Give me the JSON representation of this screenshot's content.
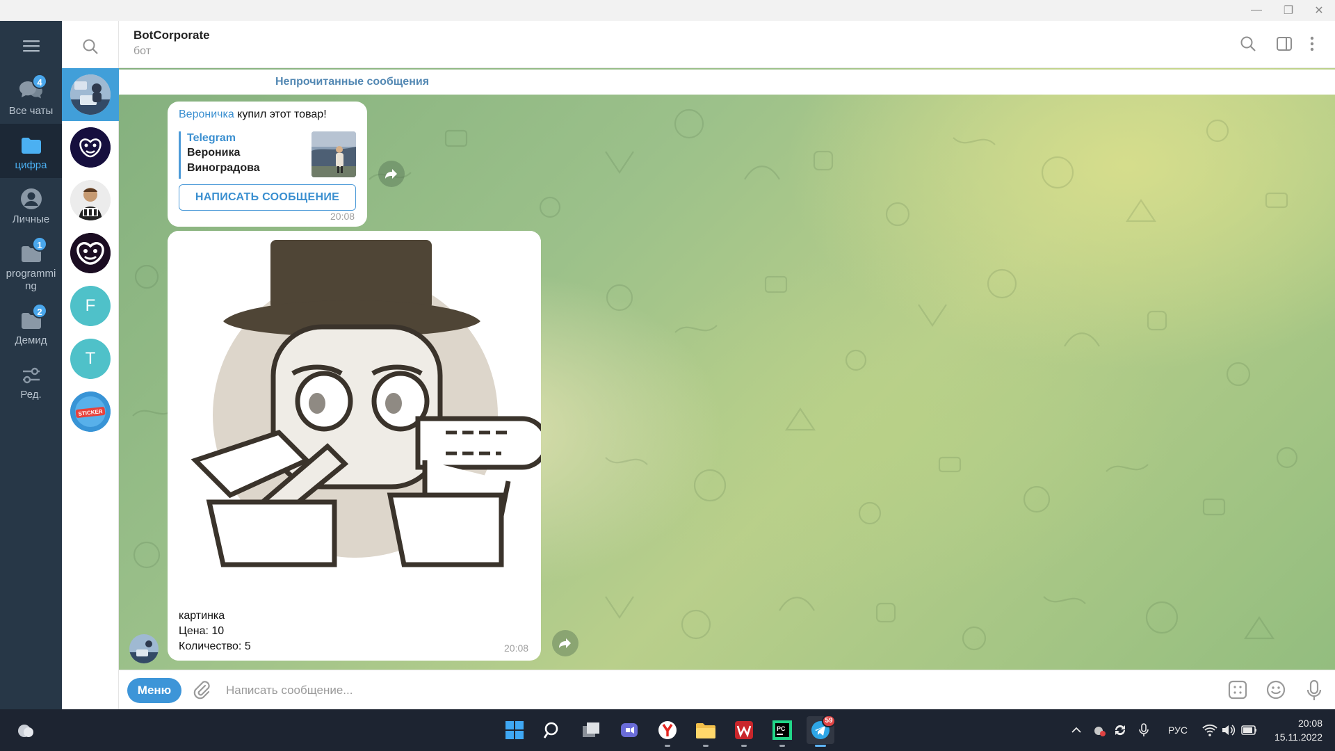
{
  "window": {
    "min": "—",
    "restore": "❐",
    "close": "✕"
  },
  "folders": [
    {
      "label": "Все чаты",
      "badge": "4",
      "icon": "chats-icon"
    },
    {
      "label": "цифра",
      "badge": "",
      "icon": "folder-icon",
      "active": true
    },
    {
      "label": "Личные",
      "badge": "",
      "icon": "person-icon"
    },
    {
      "label": "programmi ng",
      "badge": "1",
      "icon": "folder-icon"
    },
    {
      "label": "Демид",
      "badge": "2",
      "icon": "folder-icon"
    },
    {
      "label": "Ред.",
      "badge": "",
      "icon": "sliders-icon"
    }
  ],
  "chats": [
    {
      "type": "image",
      "name": "botcorporate-avatar",
      "active": true
    },
    {
      "type": "image",
      "name": "mask-avatar-1"
    },
    {
      "type": "image",
      "name": "person-avatar"
    },
    {
      "type": "image",
      "name": "mask-avatar-2"
    },
    {
      "type": "letter",
      "letter": "F",
      "color": "#4fc1c9"
    },
    {
      "type": "letter",
      "letter": "T",
      "color": "#4fc1c9"
    },
    {
      "type": "image",
      "name": "sticker-avatar"
    }
  ],
  "header": {
    "title": "BotCorporate",
    "subtitle": "бот"
  },
  "unread": {
    "label": "Непрочитанные сообщения"
  },
  "message1": {
    "sender": "Вероничка",
    "text": " купил этот товар!",
    "card_site": "Telegram",
    "card_name": "Вероника Виноградова",
    "button": "НАПИСАТЬ СООБЩЕНИЕ",
    "time": "20:08"
  },
  "message2": {
    "caption": [
      "картинка",
      "Цена: 10",
      "Количество: 5"
    ],
    "time": "20:08"
  },
  "input": {
    "menu": "Меню",
    "placeholder": "Написать сообщение..."
  },
  "taskbar": {
    "telegram_badge": "59",
    "lang": "РУС",
    "time": "20:08",
    "date": "15.11.2022"
  },
  "colors": {
    "accent": "#419fd9",
    "sidebar": "#273747",
    "badge": "#4aa7ec"
  }
}
